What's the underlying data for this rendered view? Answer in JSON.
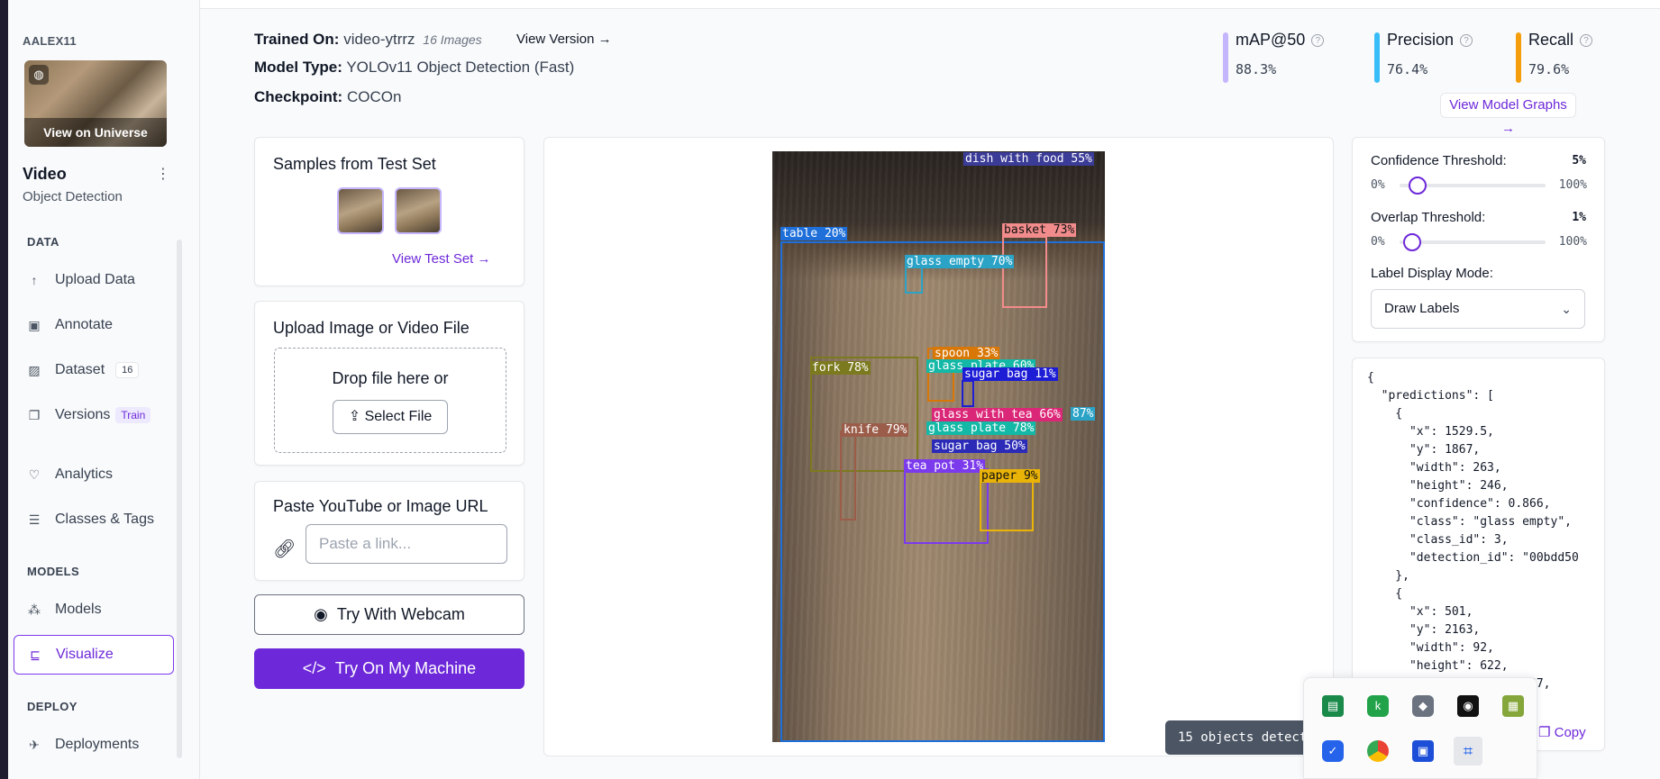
{
  "sidebar": {
    "workspace": "AALEX11",
    "thumbnail_caption": "View on Universe",
    "project_name": "Video",
    "project_type": "Object Detection",
    "sections": {
      "data": "DATA",
      "models": "MODELS",
      "deploy": "DEPLOY"
    },
    "items": [
      {
        "label": "Upload Data",
        "icon": "upload-icon"
      },
      {
        "label": "Annotate",
        "icon": "annotate-icon"
      },
      {
        "label": "Dataset",
        "icon": "dataset-icon",
        "badge": "16"
      },
      {
        "label": "Versions",
        "icon": "versions-icon",
        "badge": "Train"
      },
      {
        "label": "Analytics",
        "icon": "analytics-icon"
      },
      {
        "label": "Classes & Tags",
        "icon": "classes-icon"
      },
      {
        "label": "Models",
        "icon": "models-icon"
      },
      {
        "label": "Visualize",
        "icon": "visualize-icon"
      },
      {
        "label": "Deployments",
        "icon": "deployments-icon"
      }
    ]
  },
  "header": {
    "trained_on_label": "Trained On:",
    "trained_on_value": "video-ytrrz",
    "image_count": "16 Images",
    "view_version": "View Version →",
    "model_type_label": "Model Type:",
    "model_type_value": "YOLOv11 Object Detection (Fast)",
    "checkpoint_label": "Checkpoint:",
    "checkpoint_value": "COCOn"
  },
  "metrics": [
    {
      "name": "mAP@50",
      "value": "88.3%",
      "color": "#c4b5fd"
    },
    {
      "name": "Precision",
      "value": "76.4%",
      "color": "#38bdf8"
    },
    {
      "name": "Recall",
      "value": "79.6%",
      "color": "#f59e0b"
    }
  ],
  "view_graphs": "View Model Graphs →",
  "samples": {
    "title": "Samples from Test Set",
    "link": "View Test Set →"
  },
  "upload": {
    "title": "Upload Image or Video File",
    "drop_text": "Drop file here or",
    "select_button": "Select File"
  },
  "paste": {
    "title": "Paste YouTube or Image URL",
    "placeholder": "Paste a link..."
  },
  "webcam_button": "Try With Webcam",
  "machine_button": "Try On My Machine",
  "detections": [
    {
      "label": "dish with food 55%",
      "color": "#3b3b98"
    },
    {
      "label": "table 20%",
      "color": "#1e6fd9"
    },
    {
      "label": "basket 73%",
      "color": "#f28b8b"
    },
    {
      "label": "glass empty 70%",
      "color": "#2aa3c7"
    },
    {
      "label": "spoon 33%",
      "color": "#d97706"
    },
    {
      "label": "fork 78%",
      "color": "#7c7a1e"
    },
    {
      "label": "glass plate 60%",
      "color": "#14b8a6"
    },
    {
      "label": "sugar bag 11%",
      "color": "#1d1dd6"
    },
    {
      "label": "glass with tea 66%",
      "color": "#db2777"
    },
    {
      "label": "87%",
      "color": "#2aa3c7"
    },
    {
      "label": "knife 79%",
      "color": "#9b5d4a"
    },
    {
      "label": "glass plate 78%",
      "color": "#14b8a6"
    },
    {
      "label": "sugar bag 50%",
      "color": "#2b2bb8"
    },
    {
      "label": "tea pot 31%",
      "color": "#7c3aed"
    },
    {
      "label": "paper 9%",
      "color": "#eab308"
    }
  ],
  "object_count": "15 objects detected",
  "settings": {
    "confidence_label": "Confidence Threshold:",
    "confidence_value": "5%",
    "overlap_label": "Overlap Threshold:",
    "overlap_value": "1%",
    "min": "0%",
    "max": "100%",
    "display_mode_label": "Label Display Mode:",
    "display_mode_value": "Draw Labels"
  },
  "json_output": "{\n  \"predictions\": [\n    {\n      \"x\": 1529.5,\n      \"y\": 1867,\n      \"width\": 263,\n      \"height\": 246,\n      \"confidence\": 0.866,\n      \"class\": \"glass empty\",\n      \"class_id\": 3,\n      \"detection_id\": \"00bdd50\n    },\n    {\n      \"x\": 501,\n      \"y\": 2163,\n      \"width\": 92,\n      \"height\": 622,\n                       87,",
  "copy_button": "Copy"
}
